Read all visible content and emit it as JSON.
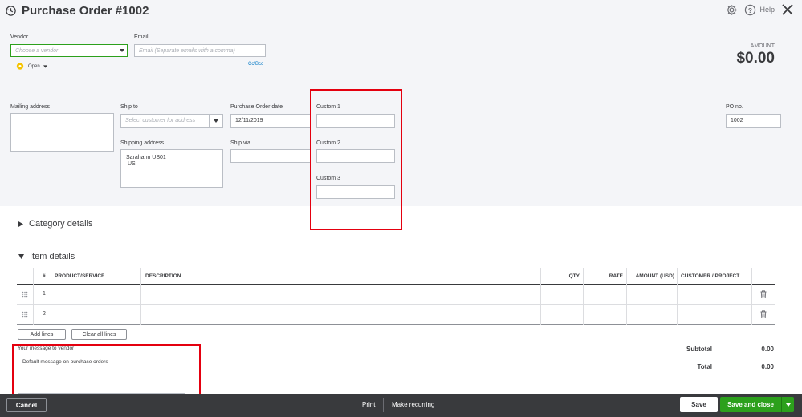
{
  "header": {
    "title": "Purchase Order #1002",
    "help_label": "Help"
  },
  "vendor": {
    "label": "Vendor",
    "placeholder": "Choose a vendor",
    "status": "Open"
  },
  "email": {
    "label": "Email",
    "placeholder": "Email (Separate emails with a comma)",
    "cc_bcc": "Cc/Bcc"
  },
  "amount": {
    "label": "AMOUNT",
    "value": "$0.00"
  },
  "mailing": {
    "label": "Mailing address"
  },
  "ship_to": {
    "label": "Ship to",
    "placeholder": "Select customer for address"
  },
  "shipping_address": {
    "label": "Shipping address",
    "line1": "Sarahann US01",
    "line2": "US"
  },
  "po_date": {
    "label": "Purchase Order date",
    "value": "12/11/2019"
  },
  "ship_via": {
    "label": "Ship via"
  },
  "custom": {
    "c1": "Custom 1",
    "c2": "Custom 2",
    "c3": "Custom 3"
  },
  "po_no": {
    "label": "PO no.",
    "value": "1002"
  },
  "sections": {
    "category": "Category details",
    "item": "Item details"
  },
  "table": {
    "columns": [
      "#",
      "PRODUCT/SERVICE",
      "DESCRIPTION",
      "QTY",
      "RATE",
      "AMOUNT (USD)",
      "CUSTOMER / PROJECT"
    ],
    "rows": [
      {
        "num": "1"
      },
      {
        "num": "2"
      }
    ]
  },
  "lines": {
    "add": "Add lines",
    "clear": "Clear all lines"
  },
  "message": {
    "label": "Your message to vendor",
    "value": "Default message on purchase orders"
  },
  "totals": {
    "subtotal_label": "Subtotal",
    "subtotal_value": "0.00",
    "total_label": "Total",
    "total_value": "0.00"
  },
  "footer": {
    "cancel": "Cancel",
    "print": "Print",
    "recurring": "Make recurring",
    "save": "Save",
    "save_close": "Save and close"
  },
  "colors": {
    "accent_green": "#2ca01c",
    "highlight_red": "#e4000f",
    "footer_bg": "#393a3d"
  }
}
